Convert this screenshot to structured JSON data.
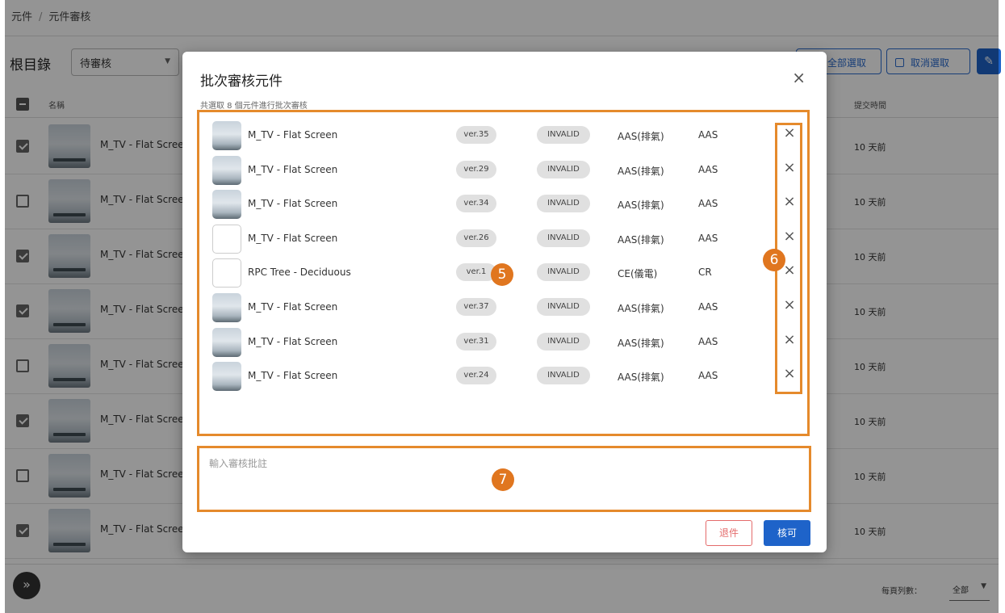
{
  "breadcrumb": {
    "item1": "元件",
    "separator": "/",
    "item2": "元件審核"
  },
  "toolbar": {
    "root_label": "根目錄",
    "status_value": "待審核",
    "select_all_label": "全部選取",
    "deselect_label": "取消選取"
  },
  "table": {
    "header_name": "名稱",
    "header_time": "提交時間",
    "rows": [
      {
        "name": "M_TV - Flat Scree",
        "time": "10 天前",
        "checked": true
      },
      {
        "name": "M_TV - Flat Scree",
        "time": "10 天前",
        "checked": false
      },
      {
        "name": "M_TV - Flat Scree",
        "time": "10 天前",
        "checked": true
      },
      {
        "name": "M_TV - Flat Scree",
        "time": "10 天前",
        "checked": true
      },
      {
        "name": "M_TV - Flat Scree",
        "time": "10 天前",
        "checked": false
      },
      {
        "name": "M_TV - Flat Scree",
        "time": "10 天前",
        "checked": true
      },
      {
        "name": "M_TV - Flat Scree",
        "time": "10 天前",
        "checked": false
      },
      {
        "name": "M_TV - Flat Scree",
        "time": "10 天前",
        "checked": true
      }
    ]
  },
  "footer": {
    "expand_icon": "»",
    "per_page_label": "每頁列數：",
    "per_page_value": "全部"
  },
  "modal": {
    "title": "批次審核元件",
    "close_icon": "×",
    "subtitle": "共選取 8 個元件進行批次審核",
    "items": [
      {
        "name": "M_TV - Flat Screen",
        "version": "ver.35",
        "status": "INVALID",
        "category": "AAS(排氣)",
        "code": "AAS",
        "has_image": true
      },
      {
        "name": "M_TV - Flat Screen",
        "version": "ver.29",
        "status": "INVALID",
        "category": "AAS(排氣)",
        "code": "AAS",
        "has_image": true
      },
      {
        "name": "M_TV - Flat Screen",
        "version": "ver.34",
        "status": "INVALID",
        "category": "AAS(排氣)",
        "code": "AAS",
        "has_image": true
      },
      {
        "name": "M_TV - Flat Screen",
        "version": "ver.26",
        "status": "INVALID",
        "category": "AAS(排氣)",
        "code": "AAS",
        "has_image": false
      },
      {
        "name": "RPC Tree - Deciduous",
        "version": "ver.1",
        "status": "INVALID",
        "category": "CE(儀電)",
        "code": "CR",
        "has_image": false
      },
      {
        "name": "M_TV - Flat Screen",
        "version": "ver.37",
        "status": "INVALID",
        "category": "AAS(排氣)",
        "code": "AAS",
        "has_image": true
      },
      {
        "name": "M_TV - Flat Screen",
        "version": "ver.31",
        "status": "INVALID",
        "category": "AAS(排氣)",
        "code": "AAS",
        "has_image": true
      },
      {
        "name": "M_TV - Flat Screen",
        "version": "ver.24",
        "status": "INVALID",
        "category": "AAS(排氣)",
        "code": "AAS",
        "has_image": true
      }
    ],
    "remove_icon": "×",
    "comment_placeholder": "輸入審核批註",
    "reject_label": "退件",
    "approve_label": "核可"
  },
  "annotations": {
    "badge5": "5",
    "badge6": "6",
    "badge7": "7"
  },
  "colors": {
    "annotation": "#e58a2c",
    "primary": "#1e63c9",
    "danger": "#e46b6b"
  }
}
